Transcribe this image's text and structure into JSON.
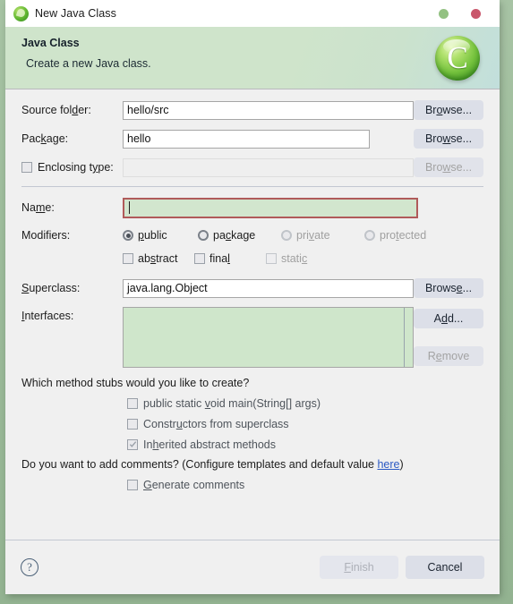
{
  "window": {
    "title": "New Java Class",
    "app_icon": "java-class-icon",
    "controls": [
      {
        "name": "minimize-button",
        "color": "#93c182"
      },
      {
        "name": "close-button",
        "color": "#c9566b"
      }
    ]
  },
  "banner": {
    "title": "Java Class",
    "subtitle": "Create a new Java class.",
    "icon": "java-class-wizard-icon",
    "icon_letter": "C",
    "background": "#cfe4cb"
  },
  "form": {
    "source_folder": {
      "label_pre": "Source fol",
      "label_mn": "d",
      "label_post": "er:",
      "value": "hello/src",
      "button": {
        "pre": "Br",
        "mn": "o",
        "post": "wse...",
        "enabled": true
      }
    },
    "package": {
      "label_pre": "Pac",
      "label_mn": "k",
      "label_post": "age:",
      "value": "hello",
      "button": {
        "pre": "Bro",
        "mn": "w",
        "post": "se...",
        "enabled": true
      }
    },
    "enclosing_type": {
      "label_pre": "Enclosing t",
      "label_mn": "y",
      "label_post": "pe:",
      "value": "",
      "checked": false,
      "enabled": false,
      "button": {
        "pre": "Bro",
        "mn": "w",
        "post": "se...",
        "enabled": false
      }
    },
    "name": {
      "label_pre": "Na",
      "label_mn": "m",
      "label_post": "e:",
      "value": "",
      "focused": true,
      "border_color": "#b05a5a",
      "background": "#d2e6ce"
    },
    "modifiers": {
      "label": "Modifiers:",
      "access": [
        {
          "pre": "",
          "mn": "p",
          "post": "ublic",
          "selected": true,
          "enabled": true
        },
        {
          "pre": "pa",
          "mn": "c",
          "post": "kage",
          "selected": false,
          "enabled": true
        },
        {
          "pre": "pri",
          "mn": "v",
          "post": "ate",
          "selected": false,
          "enabled": false
        },
        {
          "pre": "pro",
          "mn": "t",
          "post": "ected",
          "selected": false,
          "enabled": false
        }
      ],
      "flags": [
        {
          "pre": "ab",
          "mn": "s",
          "post": "tract",
          "checked": false,
          "enabled": true
        },
        {
          "pre": "fina",
          "mn": "l",
          "post": "",
          "checked": false,
          "enabled": true
        },
        {
          "pre": "stati",
          "mn": "c",
          "post": "",
          "checked": false,
          "enabled": false
        }
      ]
    },
    "superclass": {
      "label_pre": "",
      "label_mn": "S",
      "label_post": "uperclass:",
      "value": "java.lang.Object",
      "button": {
        "pre": "Brows",
        "mn": "e",
        "post": "...",
        "enabled": true
      }
    },
    "interfaces": {
      "label_pre": "",
      "label_mn": "I",
      "label_post": "nterfaces:",
      "items": [],
      "background": "#cfe6cb",
      "add_button": {
        "pre": "A",
        "mn": "d",
        "post": "d...",
        "enabled": true
      },
      "remove_button": {
        "pre": "R",
        "mn": "e",
        "post": "move",
        "enabled": false
      }
    }
  },
  "stubs": {
    "question": "Which method stubs would you like to create?",
    "options": [
      {
        "pre": "public static ",
        "mn": "v",
        "post": "oid main(String[] args)",
        "checked": false
      },
      {
        "pre": "Constr",
        "mn": "u",
        "post": "ctors from superclass",
        "checked": false
      },
      {
        "pre": "In",
        "mn": "h",
        "post": "erited abstract methods",
        "checked": true
      }
    ]
  },
  "comments": {
    "question_pre": "Do you want to add comments? (Configure templates and default value ",
    "link": "here",
    "question_post": ")",
    "option": {
      "pre": "",
      "mn": "G",
      "post": "enerate comments",
      "checked": false
    }
  },
  "footer": {
    "help_icon": "help-question-icon",
    "finish": {
      "pre": "",
      "mn": "F",
      "post": "inish",
      "enabled": false
    },
    "cancel": {
      "pre": "Cancel",
      "mn": "",
      "post": "",
      "enabled": true
    }
  }
}
